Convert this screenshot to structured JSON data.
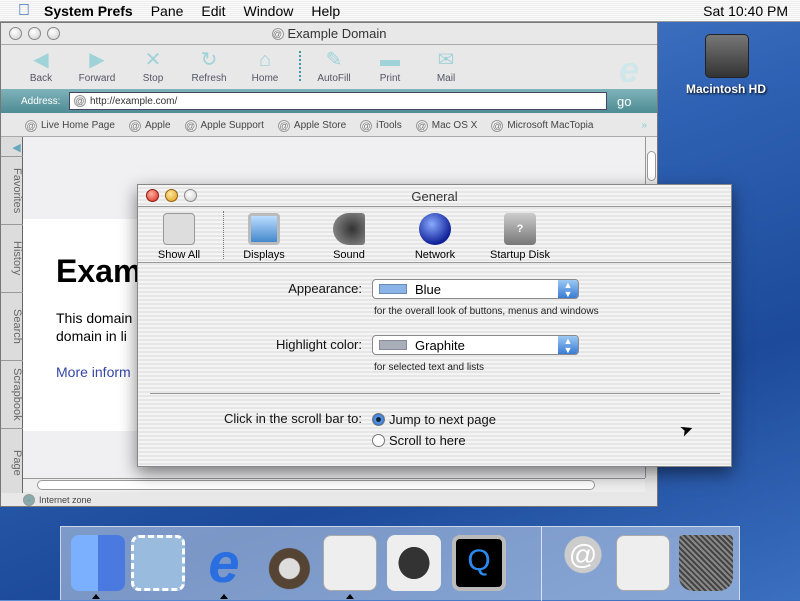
{
  "menubar": {
    "apple": "",
    "app": "System Prefs",
    "items": [
      "Pane",
      "Edit",
      "Window",
      "Help"
    ],
    "clock": "Sat 10:40 PM"
  },
  "desktop": {
    "drive_label": "Macintosh HD"
  },
  "browser": {
    "title": "Example Domain",
    "toolbar": [
      "Back",
      "Forward",
      "Stop",
      "Refresh",
      "Home",
      "AutoFill",
      "Print",
      "Mail"
    ],
    "address_label": "Address:",
    "url": "http://example.com/",
    "go": "go",
    "favorites": [
      "Live Home Page",
      "Apple",
      "Apple Support",
      "Apple Store",
      "iTools",
      "Mac OS X",
      "Microsoft MacTopia"
    ],
    "side_tabs": [
      "Favorites",
      "History",
      "Search",
      "Scrapbook",
      "Page"
    ],
    "page": {
      "heading": "Exam",
      "line1": "This domain",
      "line2": "domain in li",
      "link": "More inform"
    },
    "status": "Internet zone"
  },
  "prefs": {
    "title": "General",
    "toolbar": [
      "Show All",
      "Displays",
      "Sound",
      "Network",
      "Startup Disk"
    ],
    "appearance_label": "Appearance:",
    "appearance_value": "Blue",
    "appearance_hint": "for the overall look of buttons, menus and windows",
    "highlight_label": "Highlight color:",
    "highlight_value": "Graphite",
    "highlight_hint": "for selected text and lists",
    "scroll_label": "Click in the scroll bar to:",
    "scroll_options": [
      "Jump to next page",
      "Scroll to here"
    ],
    "scroll_selected": "Jump to next page"
  },
  "dock": [
    "Finder",
    "Mail",
    "Internet Explorer",
    "Sherlock",
    "System Preferences",
    "Displays",
    "QuickTime Player",
    "Mail URL",
    "Document",
    "Trash"
  ],
  "colors": {
    "address_bar": "#5f9ea6",
    "link": "#3546a5",
    "appearance_swatch": "#8ab4e8",
    "highlight_swatch": "#a8afb8"
  }
}
